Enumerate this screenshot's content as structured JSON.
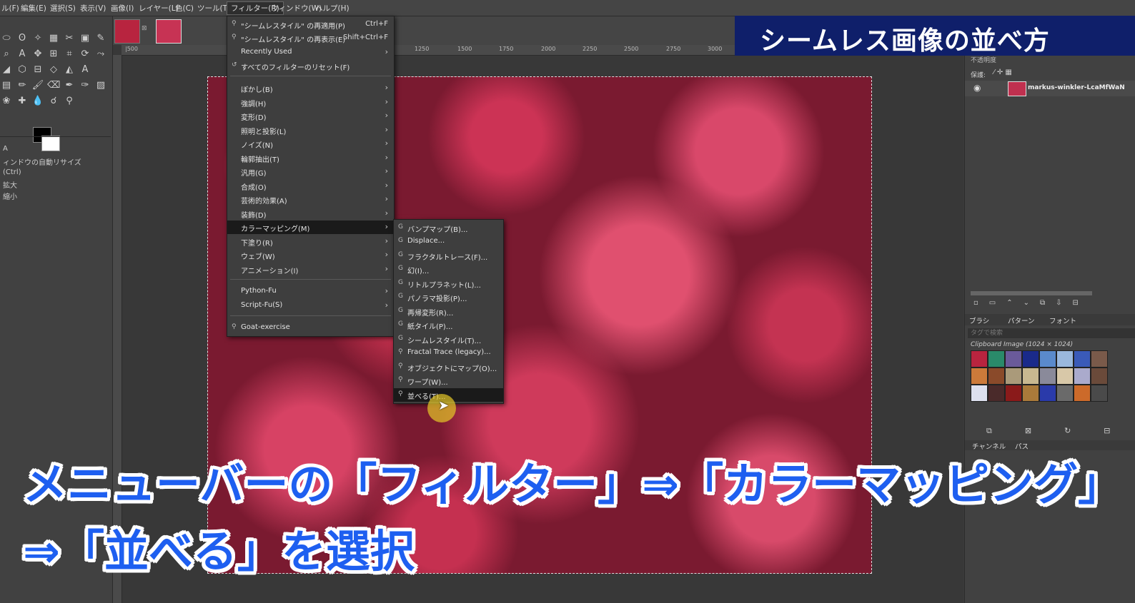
{
  "menubar": {
    "items": [
      "ル(F)",
      "編集(E)",
      "選択(S)",
      "表示(V)",
      "画像(I)",
      "レイヤー(L)",
      "色(C)",
      "ツール(T)",
      "フィルター(R)",
      "ウィンドウ(W)",
      "ヘルプ(H)"
    ],
    "active_index": 8
  },
  "filters_menu": {
    "top": [
      {
        "label": "\"シームレスタイル\" の再適用(P)",
        "shortcut": "Ctrl+F"
      },
      {
        "label": "\"シームレスタイル\" の再表示(E)",
        "shortcut": "Shift+Ctrl+F"
      },
      {
        "label": "Recently Used"
      },
      {
        "label": "すべてのフィルターのリセット(F)"
      }
    ],
    "categories": [
      "ぼかし(B)",
      "強調(H)",
      "変形(D)",
      "照明と投影(L)",
      "ノイズ(N)",
      "輪郭抽出(T)",
      "汎用(G)",
      "合成(O)",
      "芸術的効果(A)",
      "装飾(D)",
      "カラーマッピング(M)",
      "下塗り(R)",
      "ウェブ(W)",
      "アニメーション(I)"
    ],
    "highlighted": "カラーマッピング(M)",
    "scripts": [
      "Python-Fu",
      "Script-Fu(S)"
    ],
    "bottom": "Goat-exercise"
  },
  "submenu": {
    "items": [
      "バンプマップ(B)...",
      "Displace...",
      "フラクタルトレース(F)...",
      "幻(I)...",
      "リトルプラネット(L)...",
      "パノラマ投影(P)...",
      "再帰変形(R)...",
      "紙タイル(P)...",
      "シームレスタイル(T)...",
      "Fractal Trace (legacy)...",
      "オブジェクトにマップ(O)...",
      "ワープ(W)...",
      "並べる(T)..."
    ],
    "highlighted": "並べる(T)..."
  },
  "ruler": [
    "|500",
    "1250",
    "1500",
    "1750",
    "2000",
    "2250",
    "2500",
    "2750",
    "3000"
  ],
  "tool_options": {
    "line1": "A",
    "line2": "ィンドウの自動リサイズ",
    "line3": "(Ctrl)",
    "line4": "拡大",
    "line5": "縮小"
  },
  "layers": {
    "protect_label": "保護:",
    "layer_name": "markus-winkler-LcaMfWaN",
    "mode_label": "不透明度"
  },
  "brushes": {
    "tabs": [
      "ブラシ",
      "パターン",
      "フォント"
    ],
    "filter_placeholder": "タグで検索",
    "pattern_name": "Clipboard Image (1024 × 1024)",
    "bottom_tabs": [
      "チャンネル",
      "パス"
    ]
  },
  "title_banner": "シームレス画像の並べ方",
  "caption": {
    "line1": "メニューバーの「フィルター」⇒「カラーマッピング」",
    "line2": "⇒「並べる」を選択"
  },
  "colors": {
    "caption_blue": "#1e5ff0",
    "banner_bg": "#0f1f6a",
    "flower_red": "#d94466"
  }
}
